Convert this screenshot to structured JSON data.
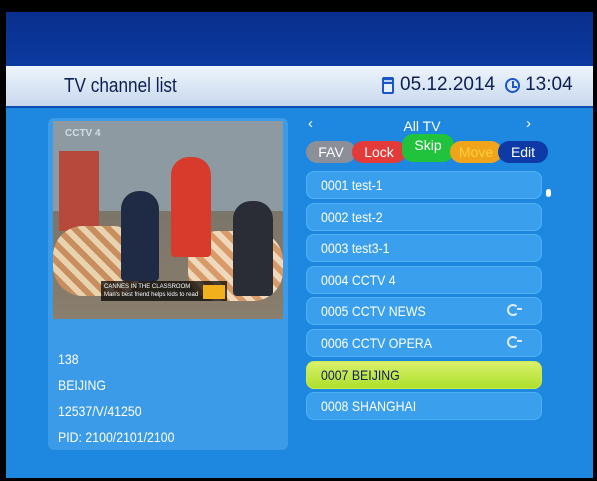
{
  "header": {
    "title": "TV channel list",
    "date": "05.12.2014",
    "time": "13:04"
  },
  "preview": {
    "logo": "CCTV 4",
    "caption_line1": "CANNES IN THE CLASSROOM",
    "caption_line2": "Man's best friend helps kids to read"
  },
  "info": {
    "number": "138",
    "name": "BEIJING",
    "transponder": "12537/V/41250",
    "pid": "PID: 2100/2101/2100"
  },
  "nav": {
    "category": "All TV",
    "prev_arrow": "‹",
    "next_arrow": "›"
  },
  "buttons": {
    "fav": "FAV",
    "lock": "Lock",
    "skip": "Skip",
    "move": "Move",
    "edit": "Edit"
  },
  "channels": [
    {
      "label": "0001 test-1",
      "icon": ""
    },
    {
      "label": "0002 test-2",
      "icon": ""
    },
    {
      "label": "0003 test3-1",
      "icon": ""
    },
    {
      "label": "0004 CCTV 4",
      "icon": ""
    },
    {
      "label": "0005 CCTV NEWS",
      "icon": "scrambled-icon"
    },
    {
      "label": "0006 CCTV OPERA",
      "icon": "scrambled-icon"
    },
    {
      "label": "0007 BEIJING",
      "icon": "",
      "selected": true
    },
    {
      "label": "0008 SHANGHAI",
      "icon": ""
    }
  ],
  "colors": {
    "background": "#1e87e0",
    "selected_row": "#aee02c",
    "lock": "#e23b3a",
    "skip": "#22c33c",
    "move": "#f0a41c",
    "edit": "#0e3aa8",
    "fav": "#8b8f98"
  }
}
